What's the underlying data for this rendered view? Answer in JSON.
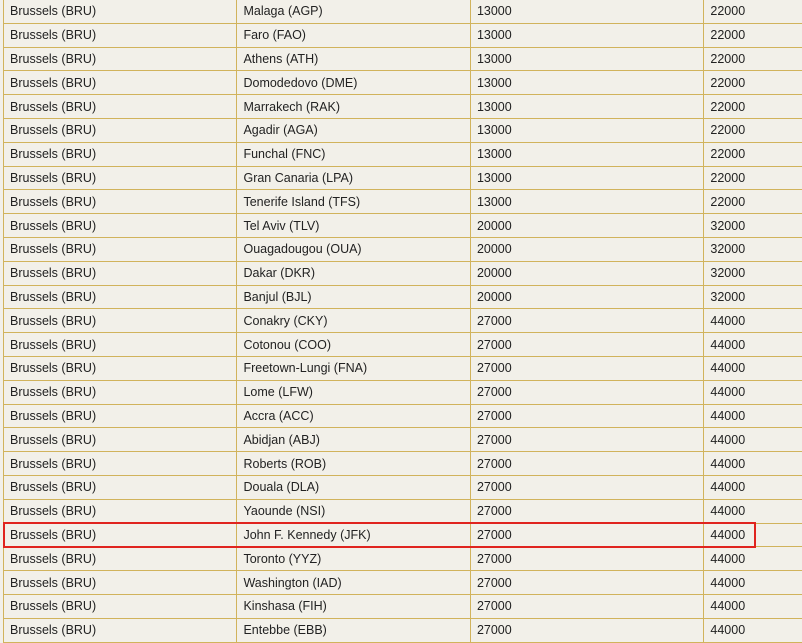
{
  "table": {
    "rows": [
      [
        "Brussels (BRU)",
        "Malaga (AGP)",
        "13000",
        "22000"
      ],
      [
        "Brussels (BRU)",
        "Faro (FAO)",
        "13000",
        "22000"
      ],
      [
        "Brussels (BRU)",
        "Athens (ATH)",
        "13000",
        "22000"
      ],
      [
        "Brussels (BRU)",
        "Domodedovo (DME)",
        "13000",
        "22000"
      ],
      [
        "Brussels (BRU)",
        "Marrakech (RAK)",
        "13000",
        "22000"
      ],
      [
        "Brussels (BRU)",
        "Agadir (AGA)",
        "13000",
        "22000"
      ],
      [
        "Brussels (BRU)",
        "Funchal (FNC)",
        "13000",
        "22000"
      ],
      [
        "Brussels (BRU)",
        "Gran Canaria (LPA)",
        "13000",
        "22000"
      ],
      [
        "Brussels (BRU)",
        "Tenerife Island (TFS)",
        "13000",
        "22000"
      ],
      [
        "Brussels (BRU)",
        "Tel Aviv (TLV)",
        "20000",
        "32000"
      ],
      [
        "Brussels (BRU)",
        "Ouagadougou (OUA)",
        "20000",
        "32000"
      ],
      [
        "Brussels (BRU)",
        "Dakar (DKR)",
        "20000",
        "32000"
      ],
      [
        "Brussels (BRU)",
        "Banjul (BJL)",
        "20000",
        "32000"
      ],
      [
        "Brussels (BRU)",
        "Conakry (CKY)",
        "27000",
        "44000"
      ],
      [
        "Brussels (BRU)",
        "Cotonou (COO)",
        "27000",
        "44000"
      ],
      [
        "Brussels (BRU)",
        "Freetown-Lungi (FNA)",
        "27000",
        "44000"
      ],
      [
        "Brussels (BRU)",
        "Lome (LFW)",
        "27000",
        "44000"
      ],
      [
        "Brussels (BRU)",
        "Accra (ACC)",
        "27000",
        "44000"
      ],
      [
        "Brussels (BRU)",
        "Abidjan (ABJ)",
        "27000",
        "44000"
      ],
      [
        "Brussels (BRU)",
        "Roberts (ROB)",
        "27000",
        "44000"
      ],
      [
        "Brussels (BRU)",
        "Douala (DLA)",
        "27000",
        "44000"
      ],
      [
        "Brussels (BRU)",
        "Yaounde (NSI)",
        "27000",
        "44000"
      ],
      [
        "Brussels (BRU)",
        "John F. Kennedy (JFK)",
        "27000",
        "44000"
      ],
      [
        "Brussels (BRU)",
        "Toronto (YYZ)",
        "27000",
        "44000"
      ],
      [
        "Brussels (BRU)",
        "Washington (IAD)",
        "27000",
        "44000"
      ],
      [
        "Brussels (BRU)",
        "Kinshasa (FIH)",
        "27000",
        "44000"
      ],
      [
        "Brussels (BRU)",
        "Entebbe (EBB)",
        "27000",
        "44000"
      ]
    ],
    "highlighted_row": "John F. Kennedy (JFK)"
  },
  "colors": {
    "background": "#f2f0e9",
    "grid": "#d1b35c",
    "highlight": "#e0241f",
    "text": "#222222"
  }
}
